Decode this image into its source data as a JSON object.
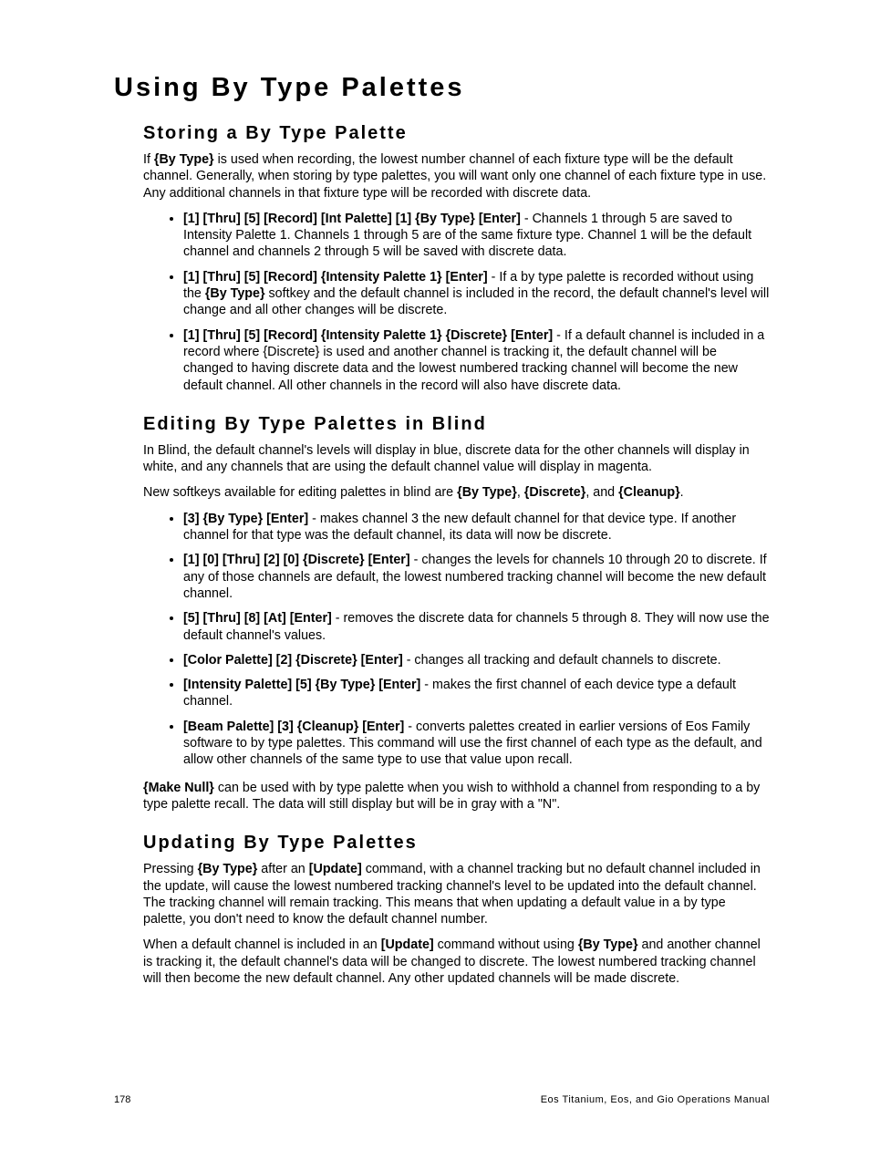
{
  "h1": "Using By Type Palettes",
  "s1": {
    "h": "Storing a By Type Palette",
    "introParts": [
      "If ",
      "{By Type}",
      " is used when recording, the lowest number channel of each fixture type will be the default channel. Generally, when storing by type palettes, you will want only one channel of each fixture type in use. Any additional channels in that fixture type will be recorded with discrete data."
    ],
    "bullets": [
      [
        "[1] [Thru] [5] [Record] [Int Palette] [1] {By Type} [Enter]",
        " - Channels 1 through 5 are saved to Intensity Palette 1. Channels 1 through 5 are of the same fixture type. Channel 1 will be the default channel and channels 2 through 5 will be saved with discrete data."
      ],
      [
        "[1] [Thru] [5] [Record] {Intensity Palette 1} [Enter]",
        " - If a by type palette is recorded without using the ",
        "{By Type}",
        " softkey and the default channel is included in the record, the default channel's level will change and all other changes will be discrete."
      ],
      [
        "[1] [Thru] [5] [Record] {Intensity Palette 1} {Discrete} [Enter]",
        " - If a default channel is included in a record where {Discrete} is used and another channel is tracking it, the default channel will be changed to having discrete data and the lowest numbered tracking channel will become the new default channel. All other channels in the record will also have discrete data."
      ]
    ]
  },
  "s2": {
    "h": "Editing By Type Palettes in Blind",
    "p1": "In Blind, the default channel's levels will display in blue, discrete data for the other channels will display in white, and any channels that are using the default channel value will display in magenta.",
    "p2Parts": [
      "New softkeys available for editing palettes in blind are ",
      "{By Type}",
      ", ",
      "{Discrete}",
      ", and ",
      "{Cleanup}",
      "."
    ],
    "bullets": [
      [
        "[3] {By Type} [Enter]",
        " - makes channel 3 the new default channel for that device type. If another channel for that type was the default channel, its data will now be discrete."
      ],
      [
        "[1] [0] [Thru] [2] [0] {Discrete} [Enter]",
        " - changes the levels for channels 10 through 20 to discrete. If any of those channels are default, the lowest numbered tracking channel will become the new default channel."
      ],
      [
        "[5] [Thru] [8] [At] [Enter]",
        " - removes the discrete data for channels 5 through 8. They will now use the default channel's values."
      ],
      [
        "[Color Palette] [2] {Discrete} [Enter]",
        " - changes all tracking and default channels to discrete."
      ],
      [
        "[Intensity Palette] [5] {By Type} [Enter]",
        " - makes the first channel of each device type a default channel."
      ],
      [
        "[Beam Palette] [3] {Cleanup} [Enter]",
        " - converts palettes created in earlier versions of Eos Family software to by type palettes. This command will use the first channel of each type as the default, and allow other channels of the same type to use that value upon recall."
      ]
    ],
    "p3Parts": [
      "{Make Null}",
      " can be used with by type palette when you wish to withhold a channel from responding to a by type palette recall. The data will still display but will be in gray with a \"N\"."
    ]
  },
  "s3": {
    "h": "Updating By Type Palettes",
    "p1Parts": [
      "Pressing ",
      "{By Type}",
      " after an ",
      "[Update]",
      " command, with a channel tracking but no default channel included in the update, will cause the lowest numbered tracking channel's level to be updated into the default channel. The tracking channel will remain tracking. This means that when updating a default value in a by type palette, you don't need to know the default channel number."
    ],
    "p2Parts": [
      "When a default channel is included in an ",
      "[Update]",
      " command without using ",
      "{By Type}",
      " and another channel is tracking it, the default channel's data will be changed to discrete. The lowest numbered tracking channel will then become the new default channel. Any other updated channels will be made discrete."
    ]
  },
  "footer": {
    "page": "178",
    "title": "Eos Titanium, Eos, and Gio Operations Manual"
  }
}
